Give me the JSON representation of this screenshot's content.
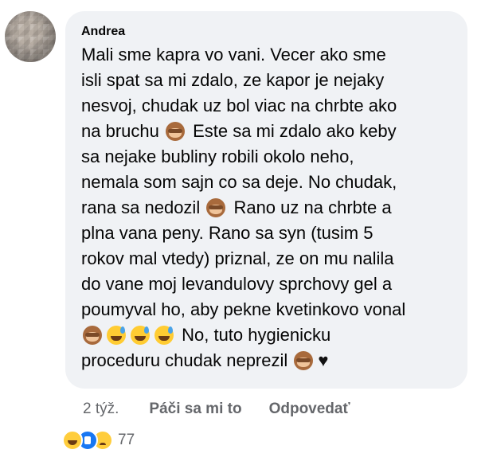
{
  "comment": {
    "author": "Andrea",
    "lines": [
      {
        "text": "Mali sme kapra vo vani. Vecer ako sme"
      },
      {
        "text": "isli spat sa mi zdalo, ze kapor je nejaky"
      },
      {
        "text": "nesvoj, chudak uz bol viac na chrbte ako"
      },
      {
        "text": "na bruchu ",
        "emoji": "see-no-evil-monkey",
        "after": " Este sa mi zdalo ako keby"
      },
      {
        "text": "sa nejake bubliny robili okolo neho,"
      },
      {
        "text": "nemala som sajn co sa deje. No chudak,"
      },
      {
        "text": "rana sa nedozil ",
        "emoji": "see-no-evil-monkey",
        "after": " Rano uz na chrbte a"
      },
      {
        "text": "plna vana peny. Rano sa syn (tusim 5"
      },
      {
        "text": "rokov mal vtedy) priznal, ze on mu nalila"
      },
      {
        "text": "do vane moj levandulovy sprchovy gel a"
      },
      {
        "text": "poumyval ho, aby pekne kvetinkovo vonal"
      },
      {
        "text": "",
        "emojis": [
          "see-no-evil-monkey",
          "sweat-smile",
          "sweat-smile",
          "sweat-smile"
        ],
        "after": " No, tuto hygienicku"
      },
      {
        "text": "proceduru chudak neprezil ",
        "emojis": [
          "see-no-evil-monkey"
        ],
        "heart": "♥"
      }
    ]
  },
  "actions": {
    "time": "2 týž.",
    "like": "Páči sa mi to",
    "reply": "Odpovedať"
  },
  "reactions": {
    "icons": [
      "haha-reaction-icon",
      "like-reaction-icon",
      "sad-reaction-icon"
    ],
    "count": "77"
  },
  "colors": {
    "bubble": "#f0f2f5",
    "text": "#050505",
    "secondary": "#65676b",
    "like_blue": "#1877f2"
  }
}
